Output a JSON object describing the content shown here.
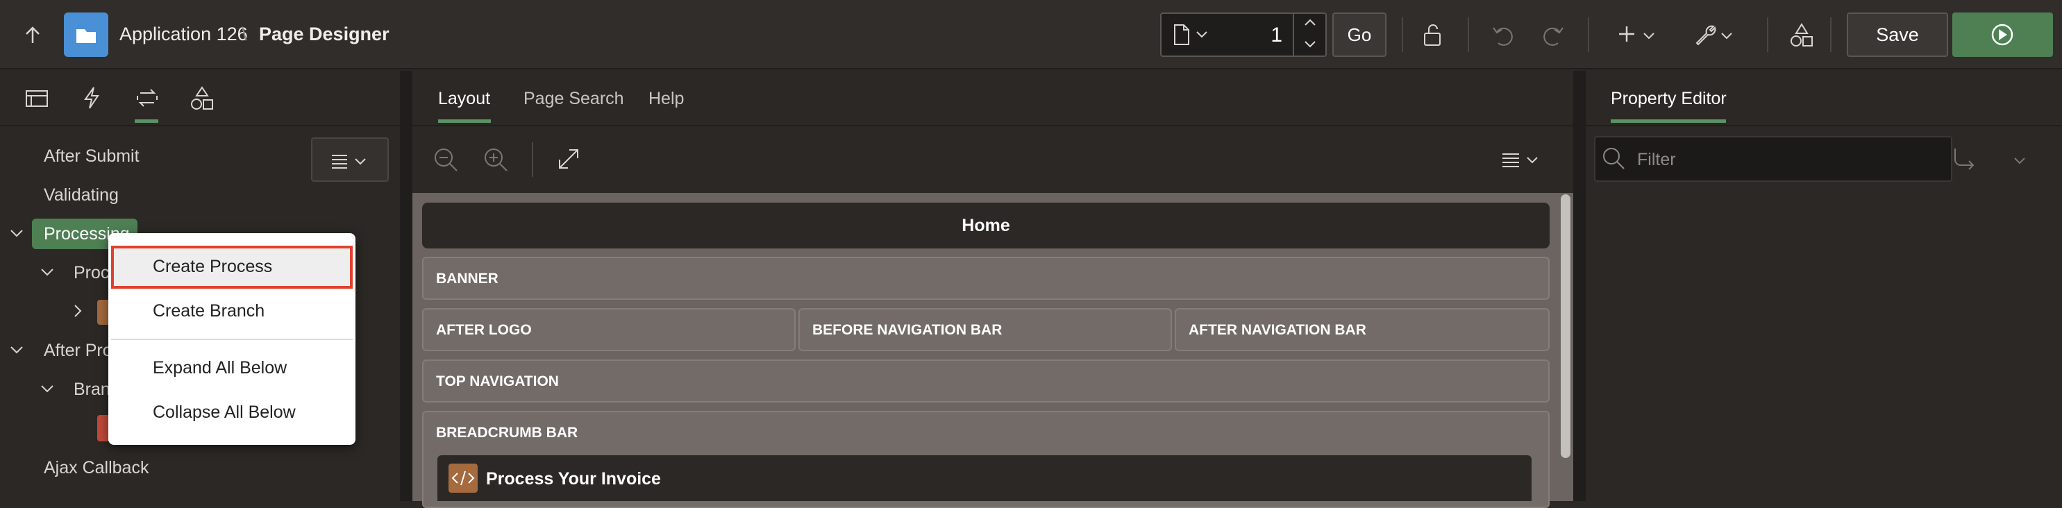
{
  "header": {
    "app_name": "Application 126",
    "separator": "\\",
    "page_name": "Page Designer",
    "page_number": "1",
    "go_label": "Go",
    "save_label": "Save"
  },
  "left_panel": {
    "tree": [
      {
        "label": "After Submit"
      },
      {
        "label": "Validating"
      },
      {
        "label": "Processing"
      },
      {
        "label": "Proc"
      },
      {
        "label": "After Pro"
      },
      {
        "label": "Bran"
      },
      {
        "label": "Ajax Callback"
      }
    ]
  },
  "context_menu": {
    "items": [
      "Create Process",
      "Create Branch",
      "Expand All Below",
      "Collapse All Below"
    ]
  },
  "center": {
    "tabs": [
      "Layout",
      "Page Search",
      "Help"
    ],
    "home_title": "Home",
    "regions": {
      "banner": "BANNER",
      "after_logo": "AFTER LOGO",
      "before_nav": "BEFORE NAVIGATION BAR",
      "after_nav": "AFTER NAVIGATION BAR",
      "top_nav": "TOP NAVIGATION",
      "breadcrumb": "BREADCRUMB BAR",
      "process_item": "Process Your Invoice"
    }
  },
  "right_panel": {
    "tab": "Property Editor",
    "filter_placeholder": "Filter"
  },
  "colors": {
    "accent_green": "#4e8054",
    "menu_highlight_border": "#e0412f",
    "app_icon": "#4a90d6"
  }
}
